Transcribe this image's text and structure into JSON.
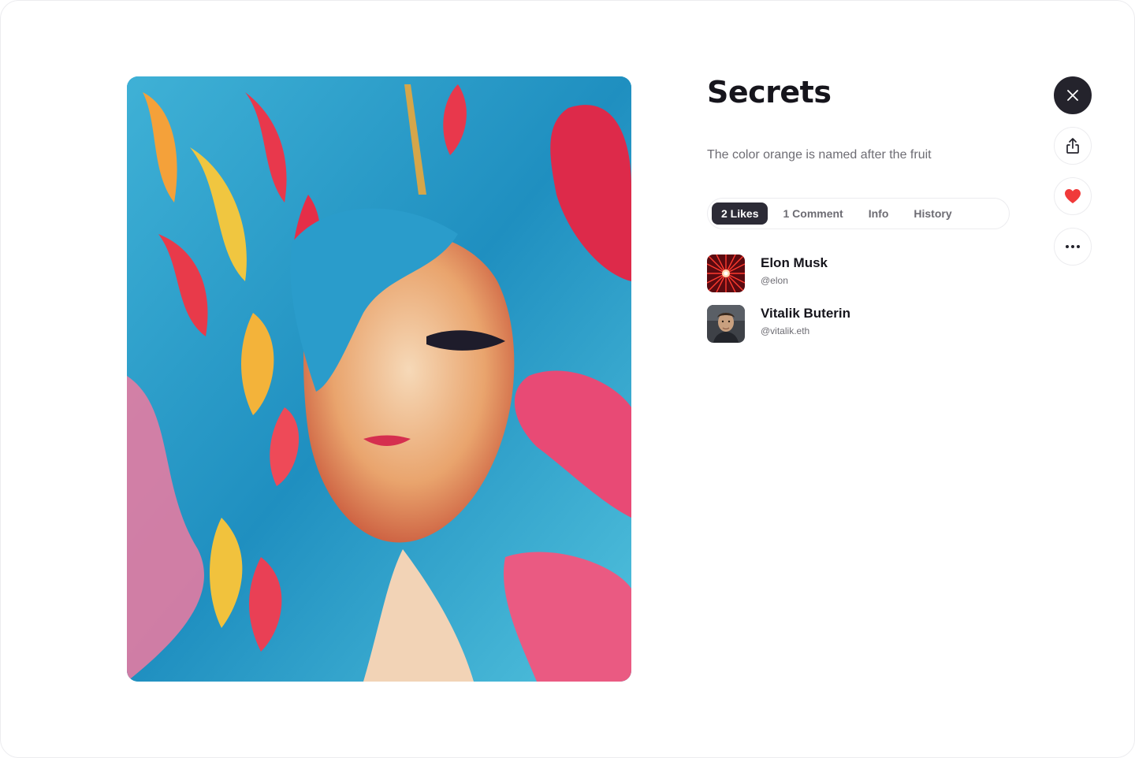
{
  "artwork": {
    "title": "Secrets",
    "description": "The color orange is named after the fruit"
  },
  "tabs": [
    {
      "label": "2 Likes",
      "active": true
    },
    {
      "label": "1 Comment",
      "active": false
    },
    {
      "label": "Info",
      "active": false
    },
    {
      "label": "History",
      "active": false
    }
  ],
  "likes": [
    {
      "name": "Elon Musk",
      "handle": "@elon",
      "avatar": "red-starburst-avatar"
    },
    {
      "name": "Vitalik Buterin",
      "handle": "@vitalik.eth",
      "avatar": "portrait-photo-avatar"
    }
  ],
  "actions": {
    "close": "close-icon",
    "share": "share-icon",
    "like": "heart-icon",
    "more": "more-dots-icon"
  },
  "colors": {
    "primary_dark": "#24232c",
    "heart": "#f03a3a",
    "muted_text": "#6d6c73"
  }
}
